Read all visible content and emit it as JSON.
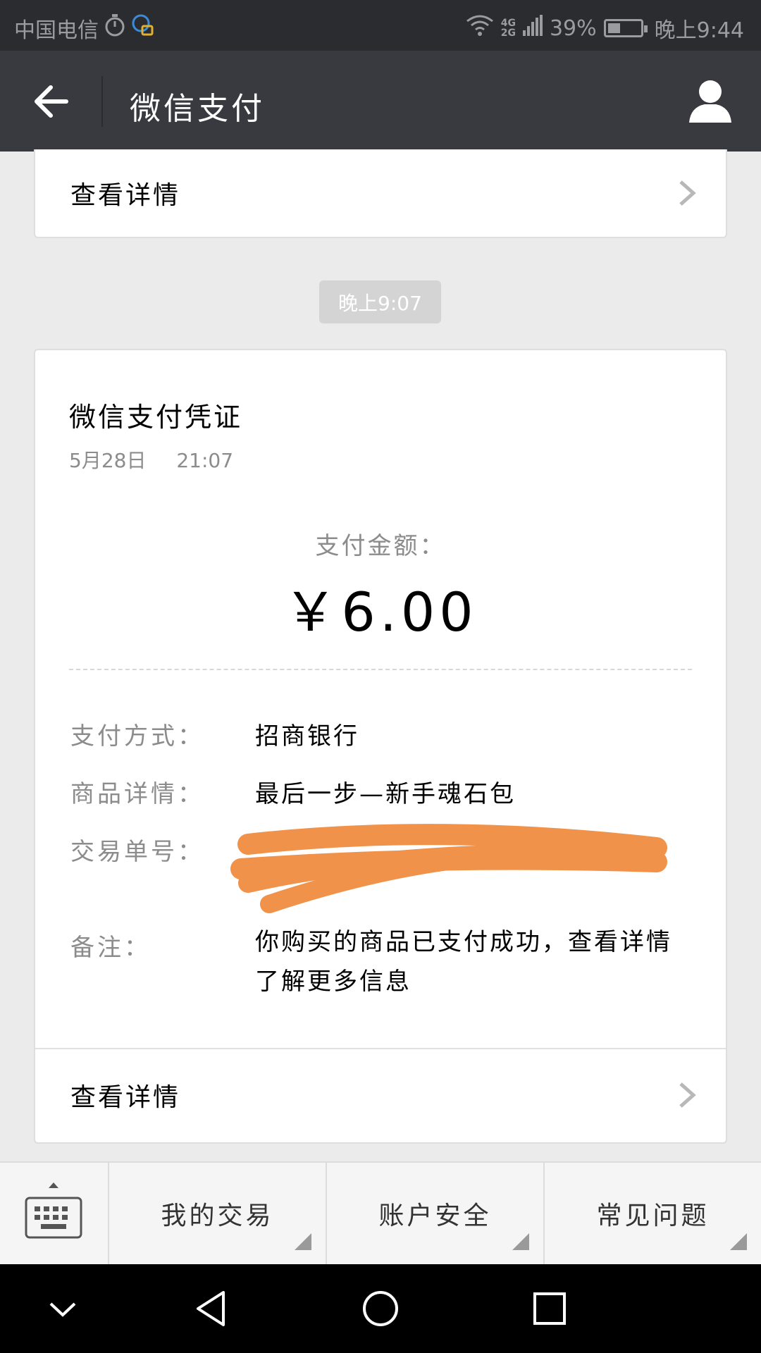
{
  "status_bar": {
    "carrier": "中国电信",
    "network_top": "4G",
    "network_bottom": "2G",
    "battery_percent": "39%",
    "battery_level": 0.39,
    "time": "晚上9:44"
  },
  "header": {
    "title": "微信支付"
  },
  "top_card": {
    "detail_label": "查看详情"
  },
  "time_divider": "晚上9:07",
  "voucher": {
    "title": "微信支付凭证",
    "date": "5月28日",
    "time": "21:07",
    "amount_label": "支付金额：",
    "amount": "￥6.00",
    "fields": {
      "payment_method_label": "支付方式：",
      "payment_method_value": "招商银行",
      "product_label": "商品详情：",
      "product_value": "最后一步—新手魂石包",
      "order_no_label": "交易单号：",
      "remark_label": "备注：",
      "remark_value": "你购买的商品已支付成功，查看详情了解更多信息"
    },
    "detail_label": "查看详情"
  },
  "bottom_menu": {
    "items": [
      {
        "label": "我的交易"
      },
      {
        "label": "账户安全"
      },
      {
        "label": "常见问题"
      }
    ]
  },
  "icons": {
    "back": "back-arrow-icon",
    "profile": "person-icon",
    "keyboard": "keyboard-icon",
    "nav_back": "triangle-back-icon",
    "nav_home": "circle-home-icon",
    "nav_recent": "square-recent-icon"
  },
  "colors": {
    "header_bg": "#393a3f",
    "statusbar_bg": "#2b2c30",
    "page_bg": "#ebebeb",
    "redaction": "#f0924a"
  }
}
